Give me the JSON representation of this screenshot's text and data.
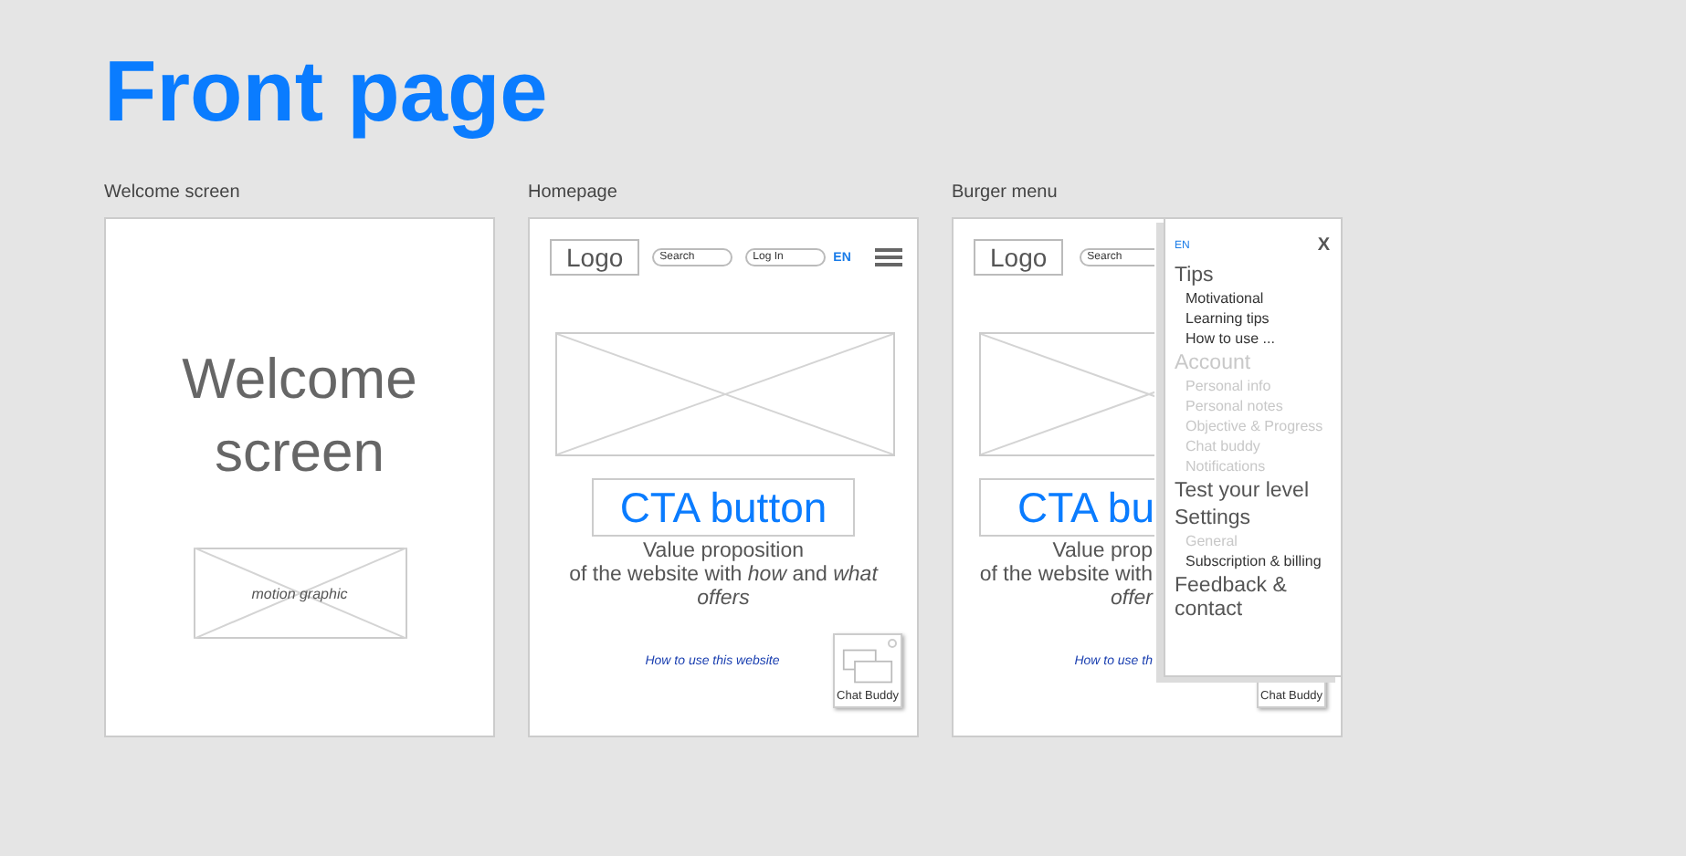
{
  "title": "Front page",
  "screens": [
    {
      "kind": "welcome",
      "label": "Welcome screen",
      "heading": "Welcome screen",
      "media_caption": "motion graphic"
    },
    {
      "kind": "homepage",
      "label": "Homepage",
      "logo": "Logo",
      "search_placeholder": "Search",
      "login_placeholder": "Log In",
      "language": "EN",
      "cta": "CTA button",
      "value_proposition": "Value proposition\nof the website with *how* and *what*\n*offers*",
      "link": "How to use this website",
      "chat_label": "Chat Buddy"
    },
    {
      "kind": "burger",
      "label": "Burger menu",
      "logo": "Logo",
      "search_placeholder": "Search",
      "cta": "CTA bu",
      "value_proposition": "Value prop\nof the website with\n*offer*",
      "link": "How to use th",
      "chat_label": "Chat Buddy",
      "menu": {
        "language": "EN",
        "close": "X",
        "sections": [
          {
            "label": "Tips",
            "disabled": false,
            "children": [
              {
                "label": "Motivational",
                "disabled": false
              },
              {
                "label": "Learning tips",
                "disabled": false
              },
              {
                "label": "How to use ...",
                "disabled": false
              }
            ]
          },
          {
            "label": "Account",
            "disabled": true,
            "children": [
              {
                "label": "Personal info",
                "disabled": true
              },
              {
                "label": "Personal notes",
                "disabled": true
              },
              {
                "label": "Objective & Progress",
                "disabled": true
              },
              {
                "label": "Chat buddy",
                "disabled": true
              },
              {
                "label": "Notifications",
                "disabled": true
              }
            ]
          },
          {
            "label": "Test your level",
            "disabled": false
          },
          {
            "label": "Settings",
            "disabled": false,
            "children": [
              {
                "label": "General",
                "disabled": true
              },
              {
                "label": "Subscription & billing",
                "disabled": false
              }
            ]
          },
          {
            "label": "Feedback & contact",
            "disabled": false
          }
        ]
      }
    }
  ]
}
